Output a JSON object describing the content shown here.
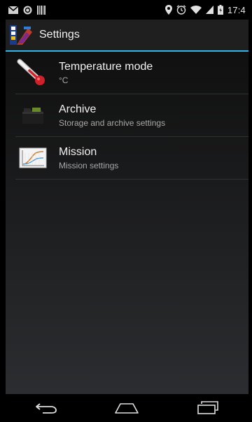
{
  "status_bar": {
    "time": "17:4",
    "icons": [
      "mail-icon",
      "sync-icon",
      "barcode-icon",
      "location-icon",
      "alarm-icon",
      "wifi-icon",
      "signal-icon",
      "battery-icon"
    ]
  },
  "action_bar": {
    "title": "Settings",
    "accent_color": "#33b5e5"
  },
  "preferences": [
    {
      "title": "Temperature mode",
      "summary": "°C",
      "icon": "thermometer-icon"
    },
    {
      "title": "Archive",
      "summary": "Storage and archive settings",
      "icon": "folder-icon"
    },
    {
      "title": "Mission",
      "summary": "Mission settings",
      "icon": "chart-icon"
    }
  ],
  "nav_bar": {
    "buttons": [
      "back-button",
      "home-button",
      "recent-apps-button"
    ]
  }
}
